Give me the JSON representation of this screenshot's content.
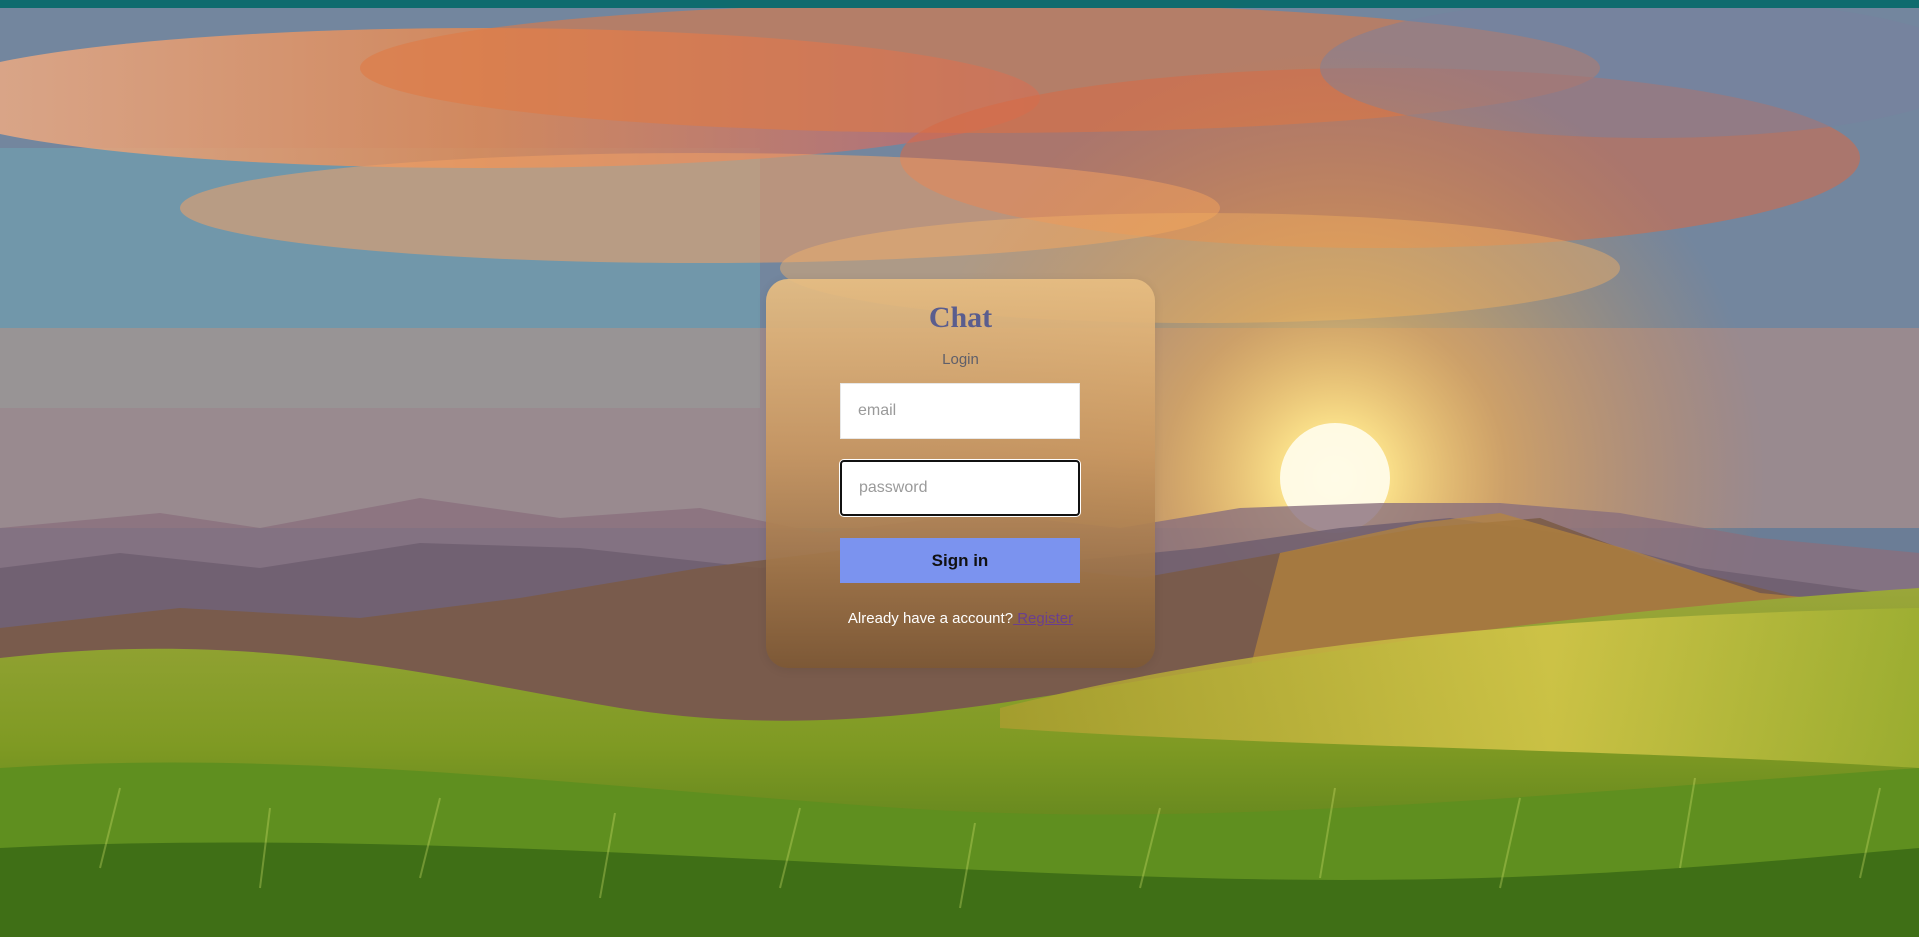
{
  "app": {
    "title": "Chat",
    "subtitle": "Login"
  },
  "form": {
    "email_value": "",
    "email_placeholder": "email",
    "password_value": "",
    "password_placeholder": "password",
    "signin_label": "Sign in",
    "account_prompt": "Already have a account?",
    "register_label": " Register"
  },
  "colors": {
    "top_strip": "#0f6b6e",
    "title": "#5a5d8e",
    "button": "#7b93ef",
    "link": "#6a3f8f"
  }
}
